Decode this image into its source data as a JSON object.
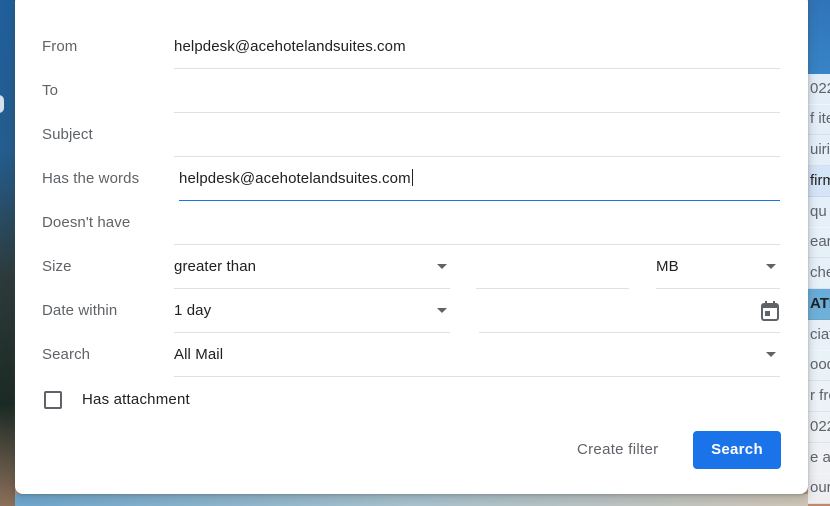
{
  "form": {
    "from": {
      "label": "From",
      "value": "helpdesk@acehotelandsuites.com"
    },
    "to": {
      "label": "To",
      "value": ""
    },
    "subject": {
      "label": "Subject",
      "value": ""
    },
    "has_words": {
      "label": "Has the words",
      "value": "helpdesk@acehotelandsuites.com"
    },
    "doesnt_have": {
      "label": "Doesn't have",
      "value": ""
    },
    "size": {
      "label": "Size",
      "operator": "greater than",
      "value": "",
      "unit": "MB"
    },
    "date_within": {
      "label": "Date within",
      "value": "1 day",
      "date": ""
    },
    "search": {
      "label": "Search",
      "value": "All Mail"
    },
    "has_attachment": {
      "label": "Has attachment",
      "checked": false
    }
  },
  "actions": {
    "create_filter": "Create filter",
    "search": "Search"
  },
  "background_list": {
    "rows": [
      {
        "text": "022",
        "style": "light"
      },
      {
        "text": "f ite",
        "style": "light"
      },
      {
        "text": "uirin",
        "style": "light"
      },
      {
        "text": "firm",
        "style": "blue"
      },
      {
        "text": "qu",
        "style": "light"
      },
      {
        "text": "ear",
        "style": "light"
      },
      {
        "text": "che",
        "style": "light"
      },
      {
        "text": "ATI",
        "style": "bold"
      },
      {
        "text": "ciat",
        "style": "light"
      },
      {
        "text": "ood",
        "style": "light"
      },
      {
        "text": "r fre",
        "style": "light"
      },
      {
        "text": "022",
        "style": "light"
      },
      {
        "text": "e a",
        "style": "light"
      },
      {
        "text": "our",
        "style": "light"
      }
    ]
  },
  "colors": {
    "primary": "#1a73e8",
    "label": "#5f6368",
    "text": "#202124",
    "divider": "#e0e0e0"
  }
}
